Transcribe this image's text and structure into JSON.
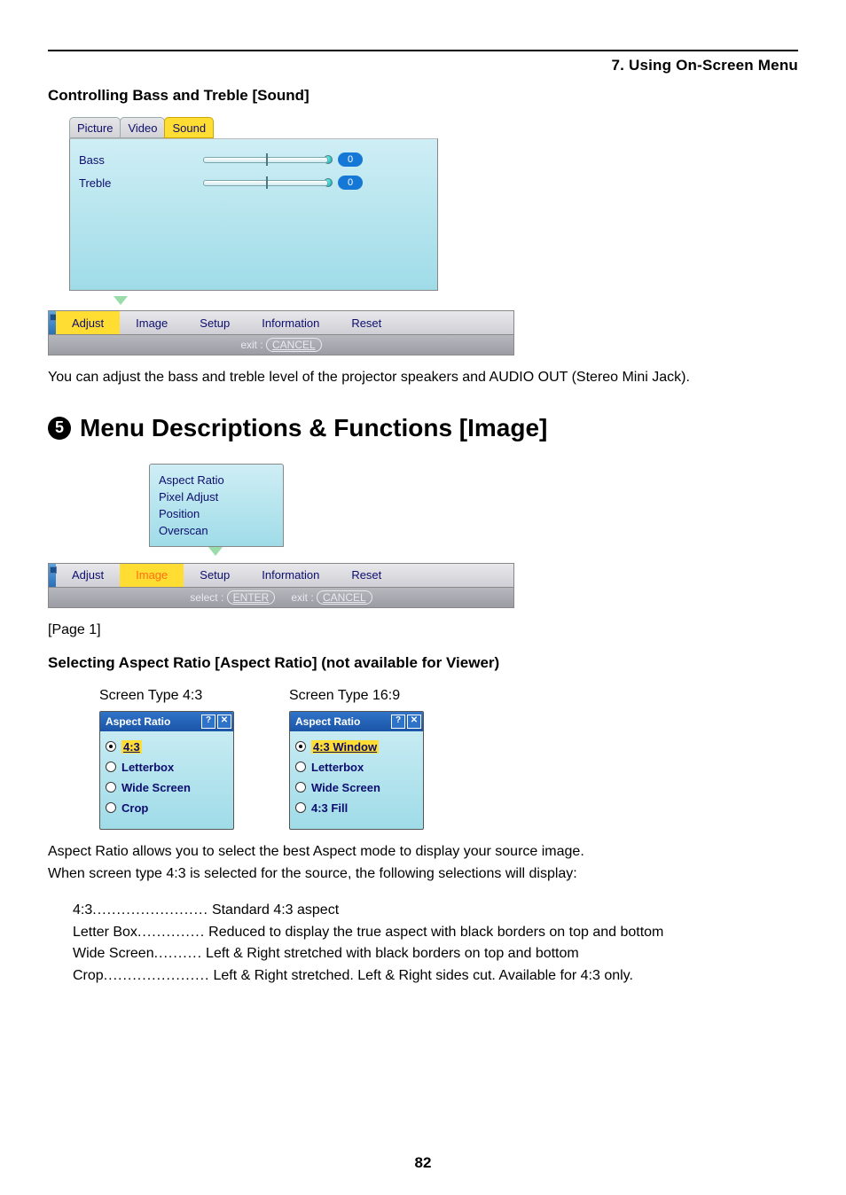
{
  "header": {
    "chapter": "7. Using On-Screen Menu",
    "section1": "Controlling Bass and Treble [Sound]",
    "desc1": "You can adjust the bass and treble level of the projector speakers and AUDIO OUT (Stereo Mini Jack).",
    "section5_num": "5",
    "section5_title": "Menu Descriptions & Functions [Image]",
    "page1_label": "[Page 1]",
    "aspect_heading": "Selecting Aspect Ratio [Aspect Ratio] (not available for Viewer)",
    "page_number": "82"
  },
  "osd_sound": {
    "tabs": [
      "Picture",
      "Video",
      "Sound"
    ],
    "selected_tab_index": 2,
    "rows": [
      {
        "label": "Bass",
        "value": "0"
      },
      {
        "label": "Treble",
        "value": "0"
      }
    ],
    "main": [
      "Adjust",
      "Image",
      "Setup",
      "Information",
      "Reset"
    ],
    "main_selected_index": 0,
    "hint_exit_label": "exit :",
    "hint_exit_btn": "CANCEL"
  },
  "osd_image": {
    "menu_items": [
      "Aspect Ratio",
      "Pixel Adjust",
      "Position",
      "Overscan"
    ],
    "main": [
      "Adjust",
      "Image",
      "Setup",
      "Information",
      "Reset"
    ],
    "main_selected_index": 1,
    "hint_select_label": "select :",
    "hint_select_btn": "ENTER",
    "hint_exit_label": "exit :",
    "hint_exit_btn": "CANCEL"
  },
  "aspect": {
    "col43_label": "Screen Type 4:3",
    "col169_label": "Screen Type 16:9",
    "dialog_title": "Aspect Ratio",
    "win_help": "?",
    "win_close": "✕",
    "opts43": [
      "4:3",
      "Letterbox",
      "Wide Screen",
      "Crop"
    ],
    "opts169": [
      "4:3 Window",
      "Letterbox",
      "Wide Screen",
      "4:3 Fill"
    ],
    "desc_intro1": "Aspect Ratio allows you to select the best Aspect mode to display your source image.",
    "desc_intro2": "When screen type 4:3 is selected for the source, the following selections will display:",
    "defs": [
      {
        "term": "4:3",
        "dots": "........................",
        "def": "Standard 4:3 aspect"
      },
      {
        "term": "Letter Box",
        "dots": "..............",
        "def": "Reduced to display the true aspect with black borders on top and bottom"
      },
      {
        "term": "Wide Screen",
        "dots": "..........",
        "def": "Left & Right stretched with black borders on top and bottom"
      },
      {
        "term": "Crop",
        "dots": "......................",
        "def": "Left & Right stretched. Left & Right sides cut. Available for 4:3 only."
      }
    ]
  }
}
